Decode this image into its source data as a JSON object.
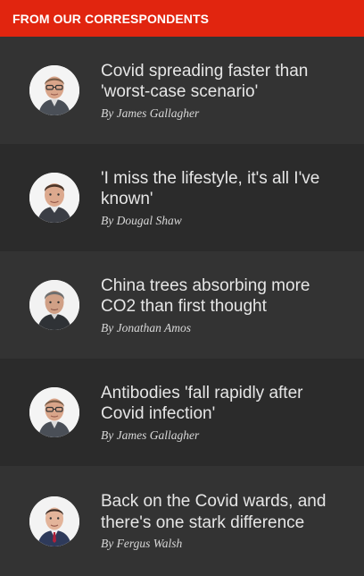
{
  "header": {
    "title": "FROM OUR CORRESPONDENTS",
    "background": "#e1250f"
  },
  "items": [
    {
      "headline": "Covid spreading faster than 'worst-case scenario'",
      "byline": "By James Gallagher",
      "avatar_icon": "james-gallagher-portrait"
    },
    {
      "headline": "'I miss the lifestyle, it's all I've known'",
      "byline": "By Dougal Shaw",
      "avatar_icon": "dougal-shaw-portrait"
    },
    {
      "headline": "China trees absorbing more CO2 than first thought",
      "byline": "By Jonathan Amos",
      "avatar_icon": "jonathan-amos-portrait"
    },
    {
      "headline": "Antibodies 'fall rapidly after Covid infection'",
      "byline": "By James Gallagher",
      "avatar_icon": "james-gallagher-portrait"
    },
    {
      "headline": "Back on the Covid wards, and there's one stark difference",
      "byline": "By Fergus Walsh",
      "avatar_icon": "fergus-walsh-portrait"
    }
  ]
}
